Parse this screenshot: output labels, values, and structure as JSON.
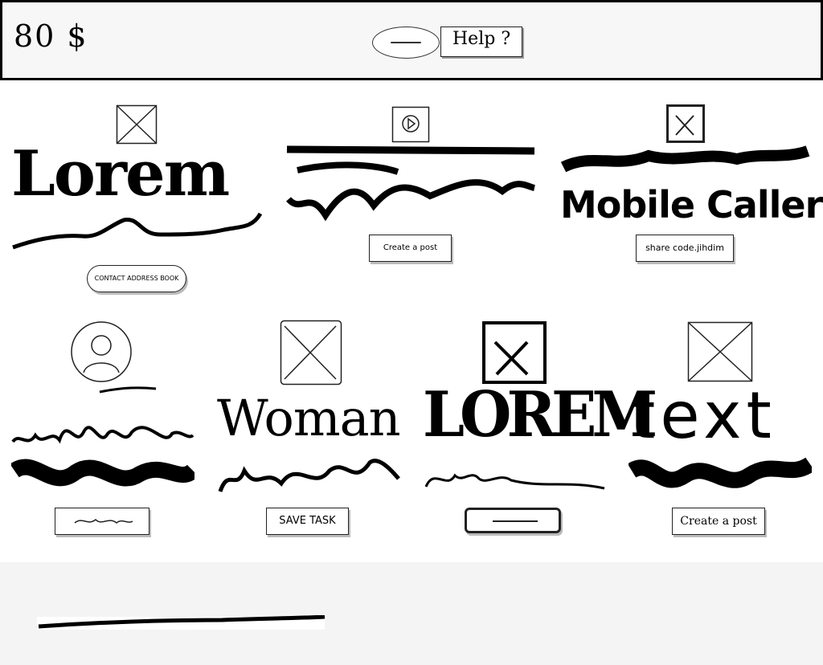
{
  "header": {
    "price": "80 $",
    "help_label": "Help ?"
  },
  "cards": [
    {
      "title": "Lorem",
      "button": "CONTACT ADDRESS BOOK",
      "image": "image-placeholder"
    },
    {
      "title": "",
      "button": "Create a post",
      "image": "play-icon"
    },
    {
      "title": "Mobile Caller",
      "button": "share code.jihdim",
      "image": "image-placeholder"
    },
    {
      "title": "",
      "button": "",
      "image": "avatar-icon"
    },
    {
      "title": "Woman",
      "button": "SAVE TASK",
      "image": "image-placeholder"
    },
    {
      "title": "LOREM",
      "button": "",
      "image": "image-placeholder"
    },
    {
      "title": "text",
      "button": "Create a post",
      "image": "image-placeholder"
    }
  ]
}
